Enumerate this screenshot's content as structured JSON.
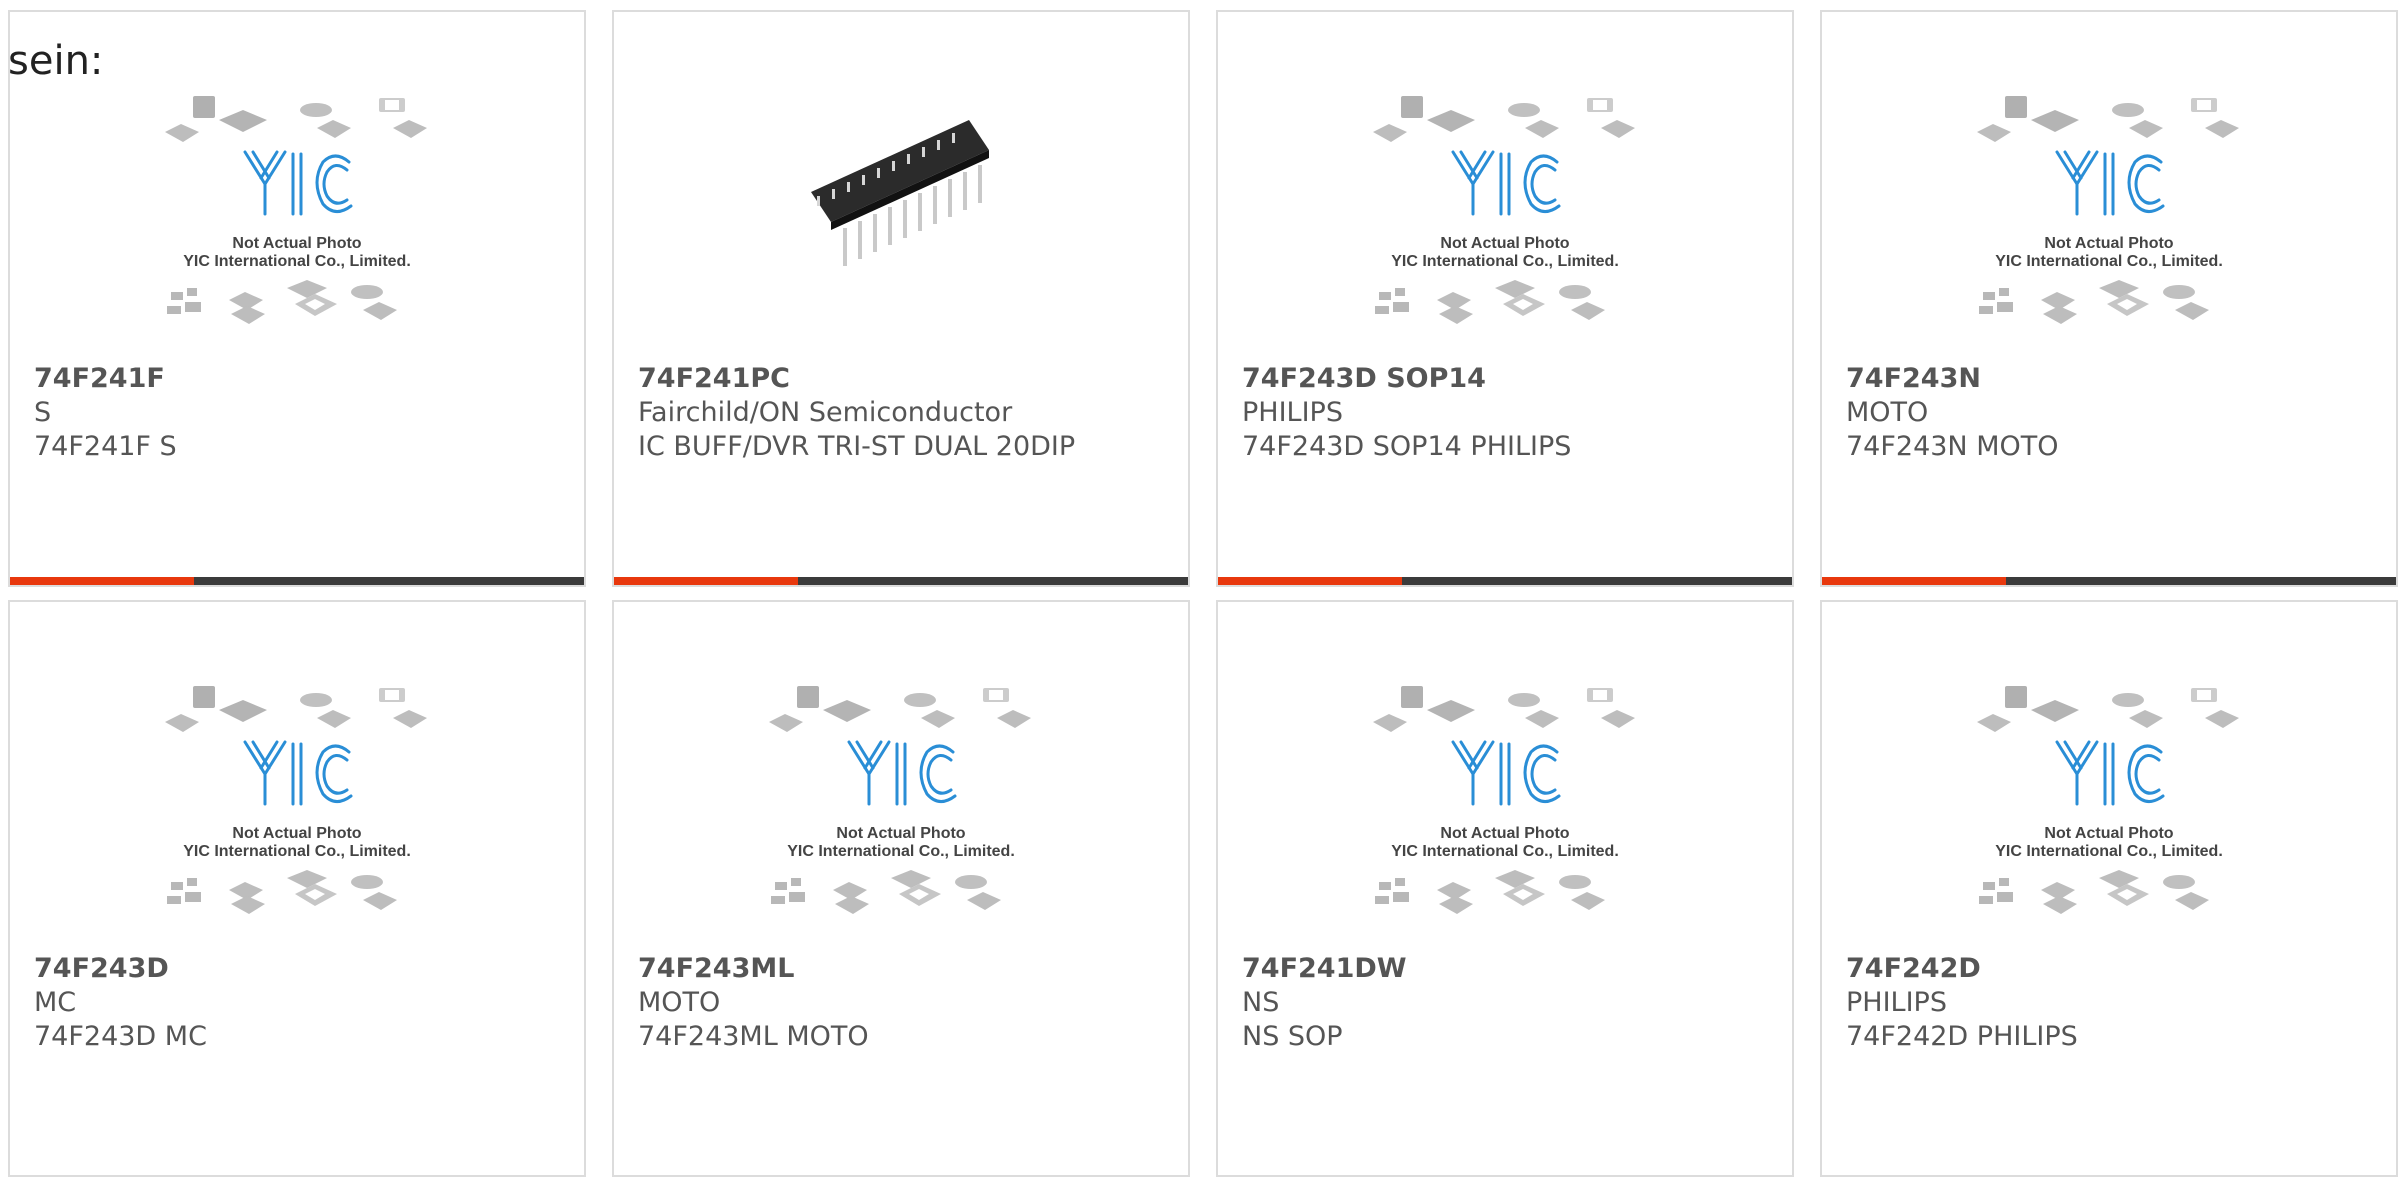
{
  "page": {
    "label": "sein:"
  },
  "colors": {
    "accent": "#e8380d",
    "bar_dark": "#3b3b3b",
    "logo_blue": "#2a8ed6",
    "card_border": "#dcdcdc",
    "text": "#555555"
  },
  "placeholder": {
    "line1": "Not Actual Photo",
    "line2": "YIC International Co., Limited."
  },
  "products": [
    {
      "part_number": "74F241F",
      "manufacturer": "S",
      "description": "74F241F S",
      "image": "placeholder",
      "progress": 0.32
    },
    {
      "part_number": "74F241PC",
      "manufacturer": "Fairchild/ON Semiconductor",
      "description": "IC BUFF/DVR TRI-ST DUAL 20DIP",
      "image": "dip-chip",
      "progress": 0.32
    },
    {
      "part_number": "74F243D SOP14",
      "manufacturer": "PHILIPS",
      "description": "74F243D SOP14 PHILIPS",
      "image": "placeholder",
      "progress": 0.32
    },
    {
      "part_number": "74F243N",
      "manufacturer": "MOTO",
      "description": "74F243N MOTO",
      "image": "placeholder",
      "progress": 0.32
    },
    {
      "part_number": "74F243D",
      "manufacturer": "MC",
      "description": "74F243D MC",
      "image": "placeholder",
      "progress": 0.32
    },
    {
      "part_number": "74F243ML",
      "manufacturer": "MOTO",
      "description": "74F243ML MOTO",
      "image": "placeholder",
      "progress": 0.32
    },
    {
      "part_number": "74F241DW",
      "manufacturer": "NS",
      "description": "NS SOP",
      "image": "placeholder",
      "progress": 0.32
    },
    {
      "part_number": "74F242D",
      "manufacturer": "PHILIPS",
      "description": "74F242D PHILIPS",
      "image": "placeholder",
      "progress": 0.32
    }
  ]
}
